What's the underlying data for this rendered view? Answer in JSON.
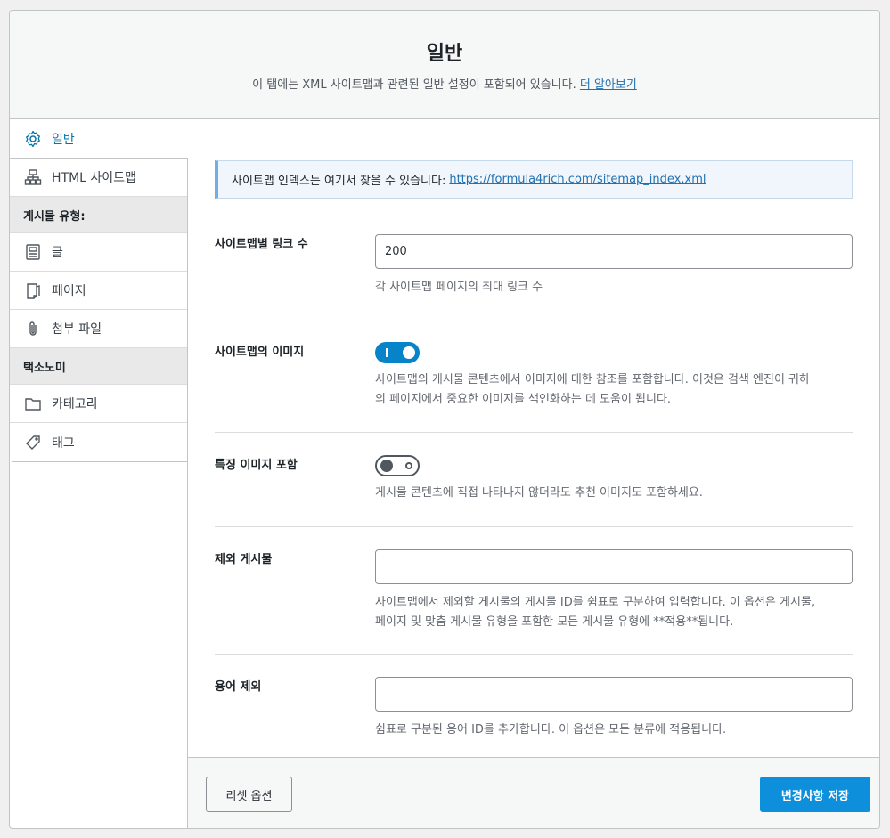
{
  "header": {
    "title": "일반",
    "description": "이 탭에는 XML 사이트맵과 관련된 일반 설정이 포함되어 있습니다.",
    "learn_more": "더 알아보기"
  },
  "sidebar": {
    "general": "일반",
    "html_sitemap": "HTML 사이트맵",
    "post_types_heading": "게시물 유형:",
    "posts": "글",
    "pages": "페이지",
    "attachments": "첨부 파일",
    "taxonomy_heading": "택소노미",
    "categories": "카테고리",
    "tags": "태그"
  },
  "notice": {
    "text": "사이트맵 인덱스는 여기서 찾을 수 있습니다:",
    "url": "https://formula4rich.com/sitemap_index.xml"
  },
  "links_per_sitemap": {
    "label": "사이트맵별 링크 수",
    "value": "200",
    "desc": "각 사이트맵 페이지의 최대 링크 수"
  },
  "images_in_sitemap": {
    "label": "사이트맵의 이미지",
    "enabled": true,
    "desc_line1": "사이트맵의 게시물 콘텐츠에서 이미지에 대한 참조를 포함합니다. 이것은 검색 엔진이 귀하",
    "desc_line2": "의 페이지에서 중요한 이미지를 색인화하는 데 도움이 됩니다."
  },
  "featured_images": {
    "label": "특징 이미지 포함",
    "enabled": false,
    "desc": "게시물 콘텐츠에 직접 나타나지 않더라도 추천 이미지도 포함하세요."
  },
  "exclude_posts": {
    "label": "제외 게시물",
    "value": "",
    "desc_line1": "사이트맵에서 제외할 게시물의 게시물 ID를 쉼표로 구분하여 입력합니다. 이 옵션은 게시물,",
    "desc_line2": "페이지 및 맞춤 게시물 유형을 포함한 모든 게시물 유형에 **적용**됩니다."
  },
  "exclude_terms": {
    "label": "용어 제외",
    "value": "",
    "desc": "쉼표로 구분된 용어 ID를 추가합니다. 이 옵션은 모든 분류에 적용됩니다."
  },
  "footer": {
    "reset": "리셋 옵션",
    "save": "변경사항 저장"
  },
  "colors": {
    "accent": "#0073aa",
    "save_button": "#0d8fdc",
    "toggle_on": "#0783c9"
  }
}
